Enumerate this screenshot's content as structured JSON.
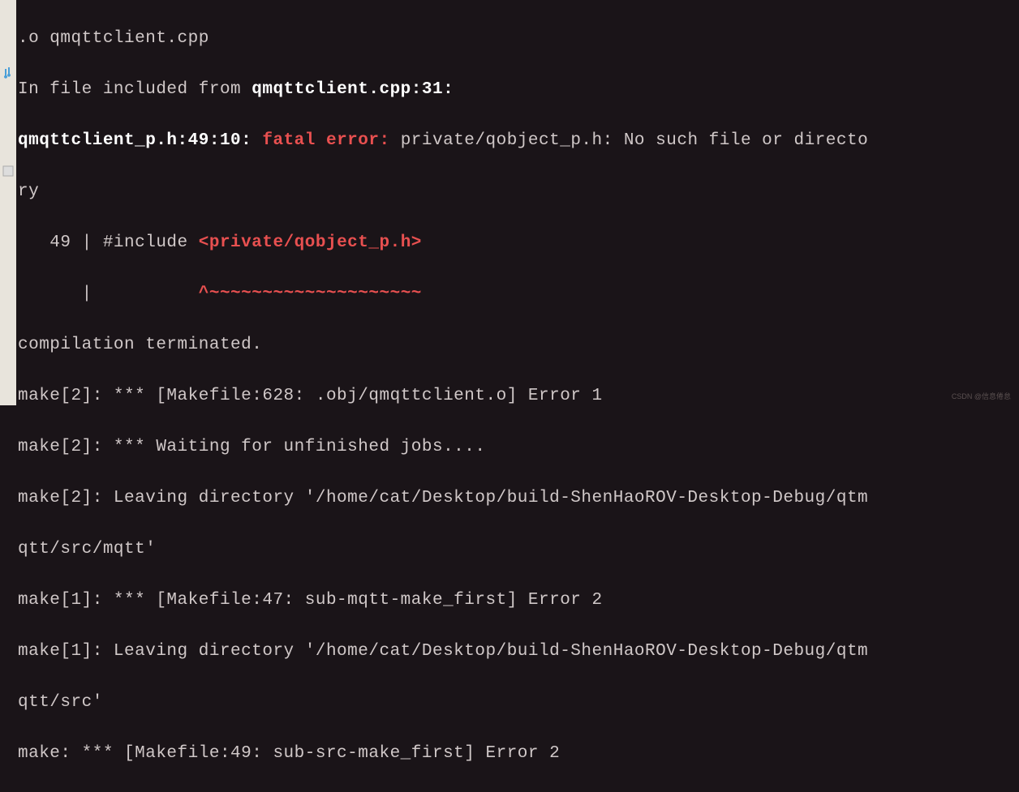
{
  "terminal": {
    "line1_a": ".o qmqttclient.cpp",
    "line2_a": "In file included from ",
    "line2_b": "qmqttclient.cpp:31:",
    "line3_a": "qmqttclient_p.h:49:10: ",
    "line3_b": "fatal error: ",
    "line3_c": "private/qobject_p.h: No such file or directo",
    "line4_a": "ry",
    "line5_a": "   49 | #include ",
    "line5_b": "<private/qobject_p.h>",
    "line6_a": "      |          ",
    "line6_b": "^~~~~~~~~~~~~~~~~~~~~",
    "line7": "compilation terminated.",
    "line8": "make[2]: *** [Makefile:628: .obj/qmqttclient.o] Error 1",
    "line9": "make[2]: *** Waiting for unfinished jobs....",
    "line10": "make[2]: Leaving directory '/home/cat/Desktop/build-ShenHaoROV-Desktop-Debug/qtm",
    "line11": "qtt/src/mqtt'",
    "line12": "make[1]: *** [Makefile:47: sub-mqtt-make_first] Error 2",
    "line13": "make[1]: Leaving directory '/home/cat/Desktop/build-ShenHaoROV-Desktop-Debug/qtm",
    "line14": "qtt/src'",
    "line15": "make: *** [Makefile:49: sub-src-make_first] Error 2"
  },
  "watermark": "CSDN @信息倦怠"
}
